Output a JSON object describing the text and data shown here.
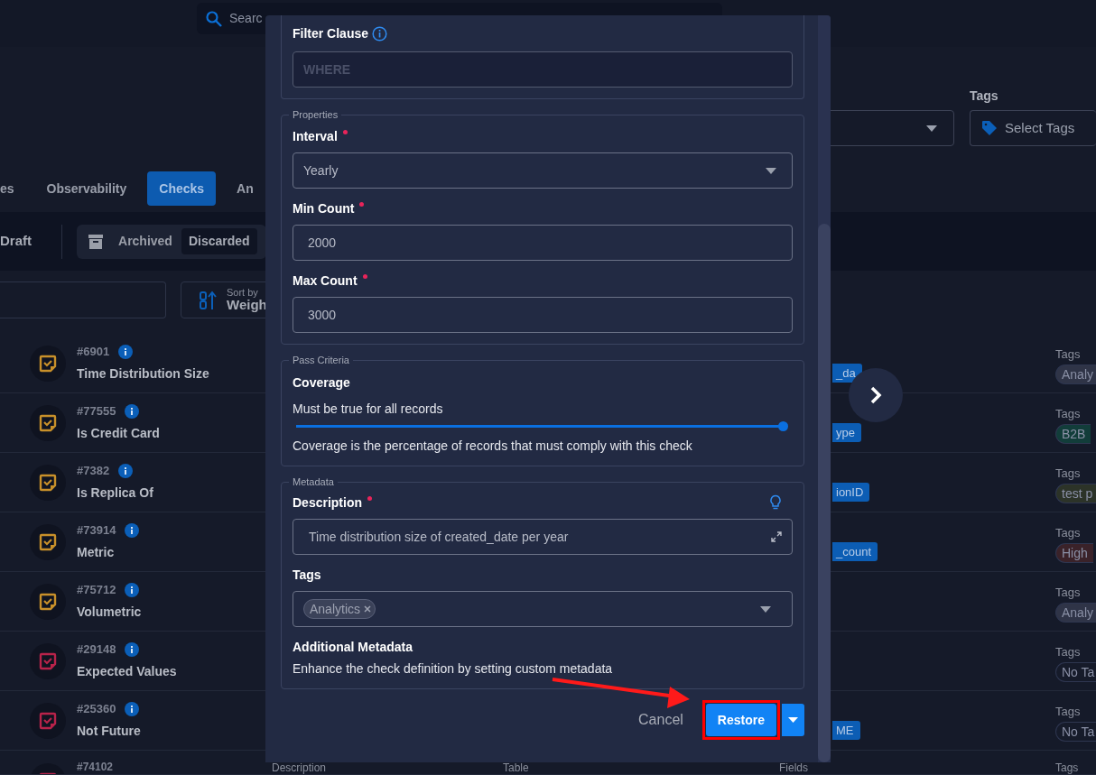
{
  "search": {
    "placeholder": "Searc"
  },
  "header": {
    "tags_label": "Tags",
    "tags_placeholder": "Select Tags"
  },
  "tabs": [
    {
      "label": "es",
      "selected": false
    },
    {
      "label": "Observability",
      "selected": false
    },
    {
      "label": "Checks",
      "selected": true
    },
    {
      "label": "An",
      "selected": false
    }
  ],
  "toolbar": {
    "draft": "Draft",
    "archived": "Archived",
    "options": [
      {
        "label": "Discarded",
        "selected": true
      }
    ]
  },
  "sort": {
    "caption": "Sort by",
    "value": "Weigh"
  },
  "rows": [
    {
      "number": "#6901",
      "title": "Time Distribution Size",
      "color": "#c8902a",
      "field": "_da",
      "tags_label": "Tags",
      "tag": {
        "label": "Analy",
        "color": "#2f3447"
      }
    },
    {
      "number": "#77555",
      "title": "Is Credit Card",
      "color": "#c8902a",
      "field": "ype",
      "tags_label": "Tags",
      "tag": {
        "label": "B2B",
        "color": "#123d3a"
      }
    },
    {
      "number": "#7382",
      "title": "Is Replica Of",
      "color": "#c8902a",
      "field": "ionID",
      "tags_label": "Tags",
      "tag": {
        "label": "test p",
        "color": "#2c3328"
      }
    },
    {
      "number": "#73914",
      "title": "Metric",
      "color": "#c8902a",
      "field": "_count",
      "tags_label": "Tags",
      "tag": {
        "label": "High",
        "color": "#3a2229"
      }
    },
    {
      "number": "#75712",
      "title": "Volumetric",
      "color": "#c8902a",
      "tags_label": "Tags",
      "tag": {
        "label": "Analy",
        "color": "#2f3447"
      }
    },
    {
      "number": "#29148",
      "title": "Expected Values",
      "color": "#b8234a",
      "tags_label": "Tags",
      "tag": {
        "label": "No Ta",
        "color": "#161b2a"
      }
    },
    {
      "number": "#25360",
      "title": "Not Future",
      "color": "#b8234a",
      "field": "ME",
      "tags_label": "Tags",
      "tag": {
        "label": "No Ta",
        "color": "#161b2a"
      }
    }
  ],
  "partial_row": {
    "number": "#74102",
    "color": "#b8234a",
    "column_labels": [
      "Description",
      "Table",
      "Fields",
      "Tags"
    ]
  },
  "modal": {
    "filter": {
      "label": "Filter Clause",
      "placeholder": "WHERE"
    },
    "properties": {
      "legend": "Properties",
      "fields": [
        {
          "label": "Interval",
          "required": true,
          "kind": "select",
          "value": "Yearly"
        },
        {
          "label": "Min Count",
          "required": true,
          "kind": "input",
          "value": "2000"
        },
        {
          "label": "Max Count",
          "required": true,
          "kind": "input",
          "value": "3000"
        }
      ]
    },
    "pass_criteria": {
      "legend": "Pass Criteria",
      "title": "Coverage",
      "caption": "Must be true for all records",
      "level": 1,
      "help": "Coverage is the percentage of records that must comply with this check"
    },
    "metadata": {
      "legend": "Metadata",
      "description": {
        "label": "Description",
        "required": true,
        "value": "Time distribution size of created_date per year"
      },
      "tags": {
        "label": "Tags",
        "chips": [
          "Analytics"
        ]
      },
      "additional": {
        "title": "Additional Metadata",
        "text": "Enhance the check definition by setting custom metadata"
      }
    },
    "footer": {
      "cancel": "Cancel",
      "primary": "Restore"
    }
  },
  "annotation": {
    "arrow": true,
    "highlight": true
  }
}
